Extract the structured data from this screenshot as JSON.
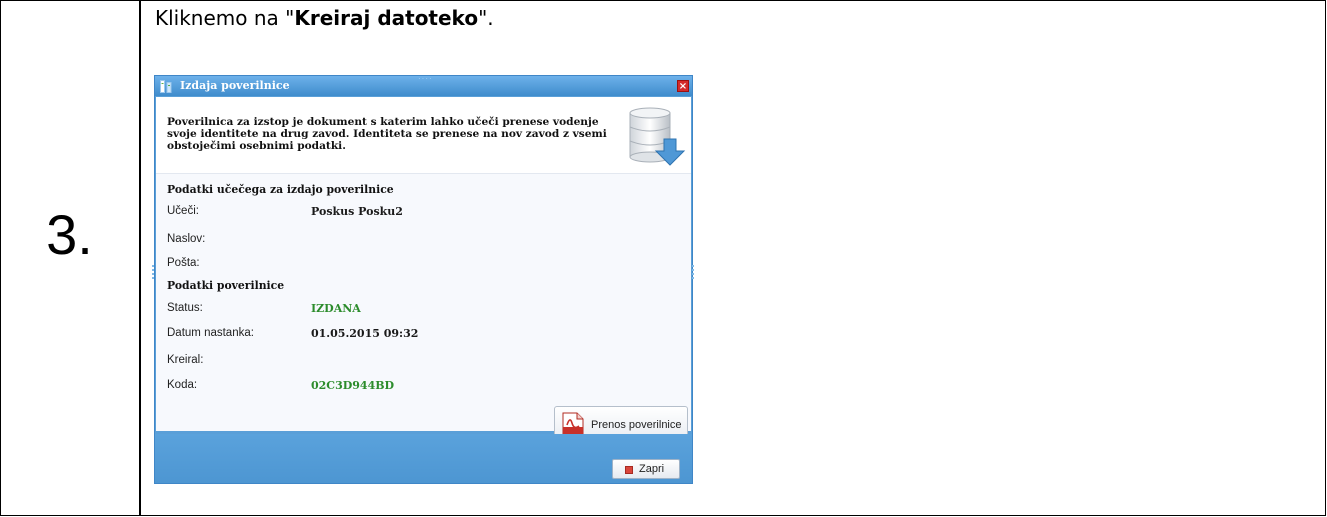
{
  "document": {
    "step_number": "3.",
    "instruction_prefix": "Kliknemo na \"",
    "instruction_bold": "Kreiraj datoteko",
    "instruction_suffix": "\"."
  },
  "dialog": {
    "title": "Izdaja poverilnice",
    "close_symbol": "×",
    "intro_text": "Poverilnica za izstop je dokument s katerim lahko učeči prenese vodenje svoje identitete na drug zavod. Identiteta se prenese na nov zavod z vsemi obstoječimi osebnimi podatki.",
    "section_student": "Podatki učečega za izdajo poverilnice",
    "section_credential": "Podatki poverilnice",
    "fields": {
      "ucenci_label": "Učeči:",
      "ucenci_value": "Poskus Posku2",
      "naslov_label": "Naslov:",
      "naslov_value": "",
      "posta_label": "Pošta:",
      "posta_value": "",
      "status_label": "Status:",
      "status_value": "IZDANA",
      "datum_label": "Datum nastanka:",
      "datum_value": "01.05.2015 09:32",
      "kreiral_label": "Kreiral:",
      "kreiral_value": "",
      "koda_label": "Koda:",
      "koda_value": "02C3D944BD"
    },
    "button_prenos": "Prenos poverilnice",
    "button_zapri": "Zapri"
  },
  "colors": {
    "dialog_frame": "#5a9fd8",
    "status_green": "#2c8c2c",
    "close_red": "#d42a2a"
  }
}
